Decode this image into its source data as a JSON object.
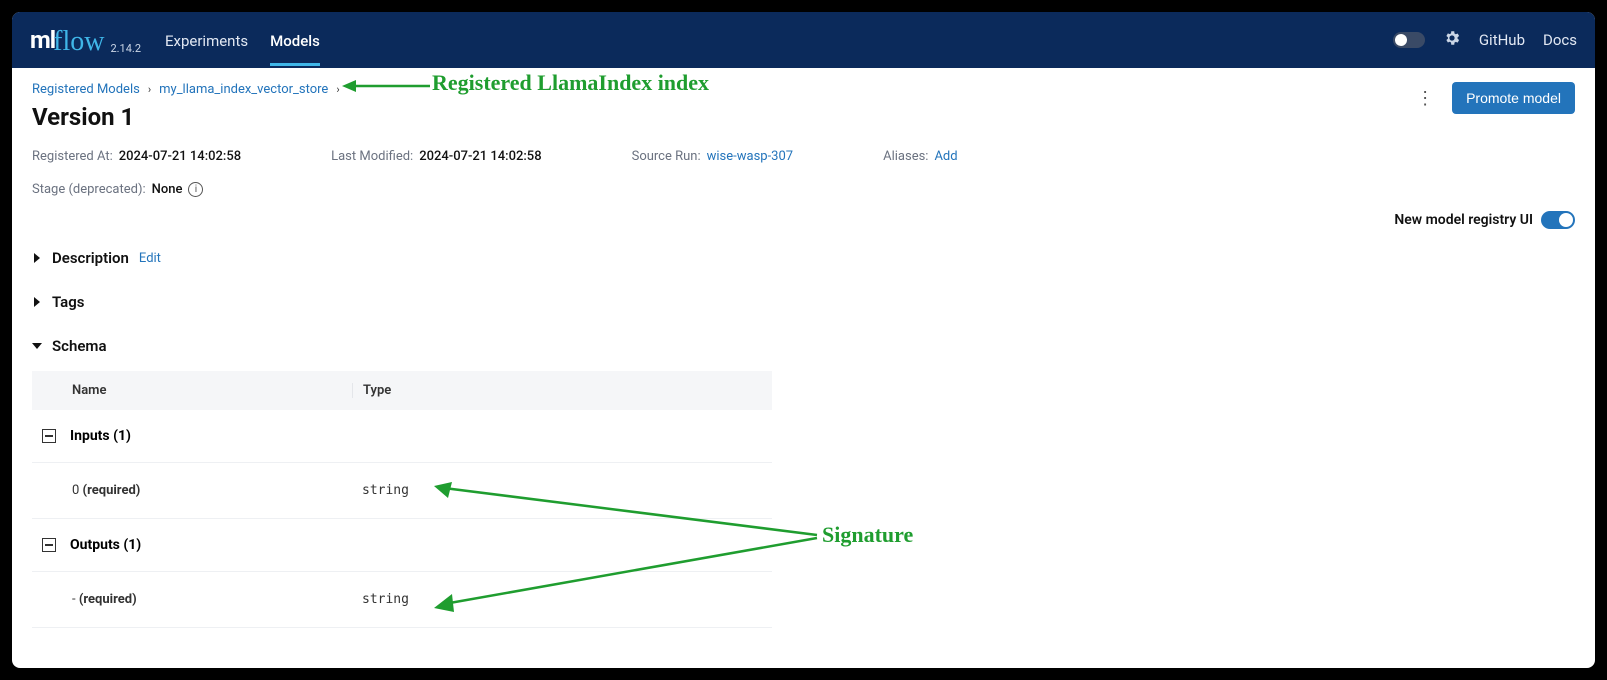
{
  "brand": {
    "ml": "ml",
    "flow": "flow",
    "version": "2.14.2"
  },
  "nav": {
    "experiments": "Experiments",
    "models": "Models",
    "github": "GitHub",
    "docs": "Docs"
  },
  "breadcrumb": {
    "root": "Registered Models",
    "model": "my_llama_index_vector_store"
  },
  "page_title": "Version 1",
  "actions": {
    "promote": "Promote model"
  },
  "meta": {
    "registered_at_label": "Registered At:",
    "registered_at_value": "2024-07-21 14:02:58",
    "last_modified_label": "Last Modified:",
    "last_modified_value": "2024-07-21 14:02:58",
    "source_run_label": "Source Run:",
    "source_run_value": "wise-wasp-307",
    "aliases_label": "Aliases:",
    "aliases_action": "Add"
  },
  "stage": {
    "label": "Stage (deprecated):",
    "value": "None"
  },
  "registry_toggle": "New model registry UI",
  "sections": {
    "description": "Description",
    "edit": "Edit",
    "tags": "Tags",
    "schema": "Schema"
  },
  "schema": {
    "col_name": "Name",
    "col_type": "Type",
    "inputs_header": "Inputs (1)",
    "outputs_header": "Outputs (1)",
    "input_row": {
      "name": "0",
      "required": "(required)",
      "type": "string"
    },
    "output_row": {
      "name": "-",
      "required": "(required)",
      "type": "string"
    }
  },
  "annotations": {
    "top": "Registered LlamaIndex index",
    "signature": "Signature"
  }
}
